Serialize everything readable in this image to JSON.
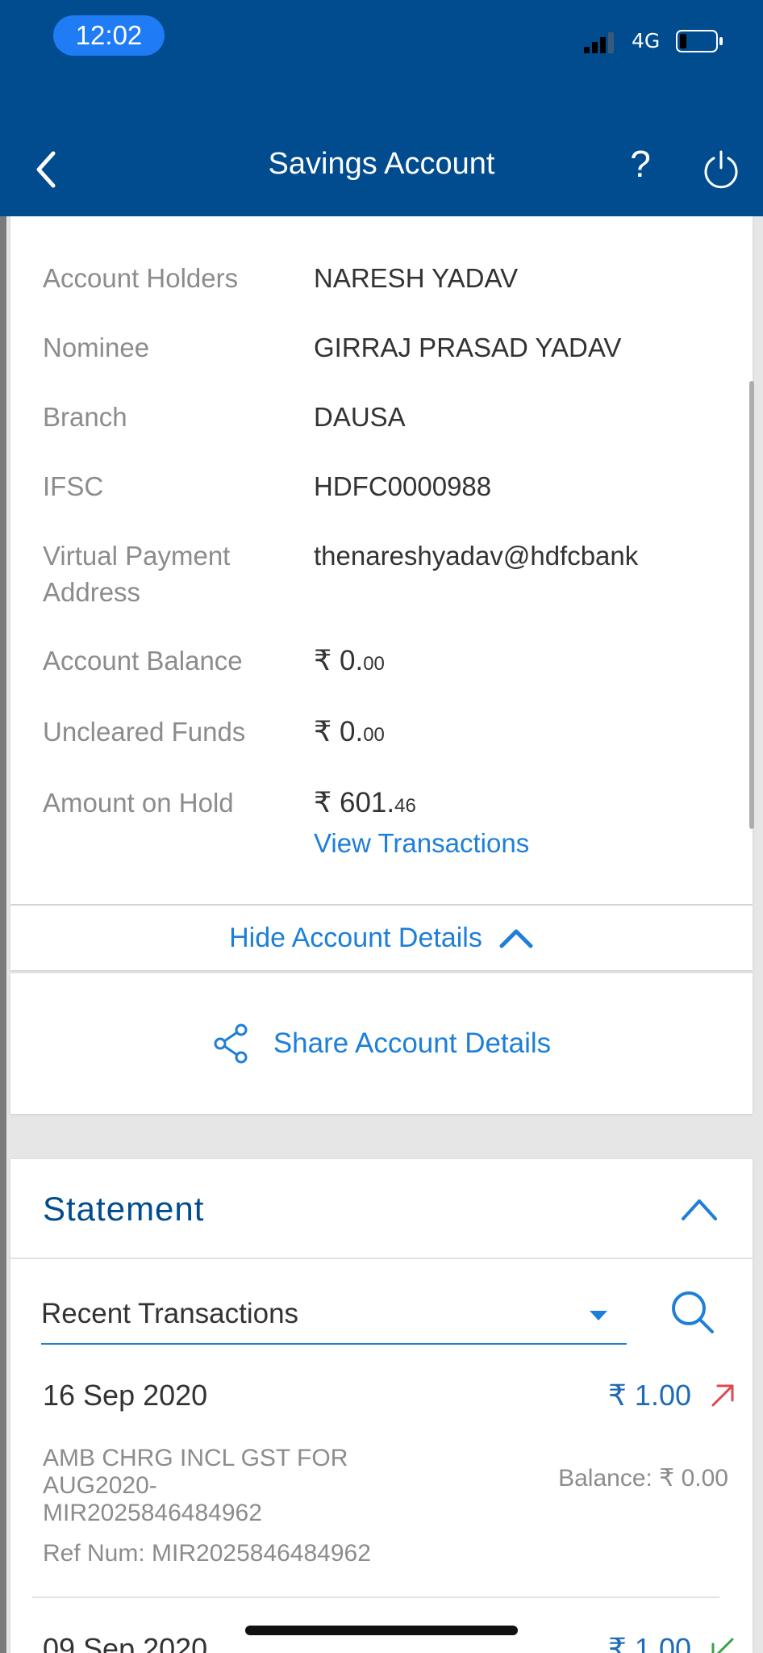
{
  "status_bar": {
    "time": "12:02",
    "network": "4G"
  },
  "header": {
    "title": "Savings Account",
    "help_label": "?"
  },
  "account_details": {
    "holders_label": "Account Holders",
    "holders_value": "NARESH YADAV",
    "nominee_label": "Nominee",
    "nominee_value": "GIRRAJ PRASAD YADAV",
    "branch_label": "Branch",
    "branch_value": "DAUSA",
    "ifsc_label": "IFSC",
    "ifsc_value": "HDFC0000988",
    "vpa_label_line1": "Virtual Payment",
    "vpa_label_line2": "Address",
    "vpa_value": "thenareshyadav@hdfcbank",
    "balance_label": "Account Balance",
    "balance_main": "₹ 0.",
    "balance_dec": "00",
    "uncleared_label": "Uncleared Funds",
    "uncleared_main": "₹ 0.",
    "uncleared_dec": "00",
    "hold_label": "Amount on Hold",
    "hold_main": "₹ 601.",
    "hold_dec": "46",
    "view_transactions": "View Transactions"
  },
  "hide_details_label": "Hide Account Details",
  "share_details_label": "Share Account Details",
  "statement": {
    "title": "Statement",
    "filter_value": "Recent Transactions",
    "transactions": [
      {
        "date": "16 Sep 2020",
        "amount": "₹ 1.00",
        "direction": "debit",
        "desc_line1": "AMB CHRG INCL GST FOR",
        "desc_line2": "AUG2020-",
        "desc_line3": "MIR2025846484962",
        "ref": "Ref Num: MIR2025846484962",
        "balance": "Balance: ₹ 0.00"
      },
      {
        "date": "09 Sep 2020",
        "amount": "₹ 1.00",
        "direction": "credit"
      }
    ]
  },
  "colors": {
    "header_bg": "#004c8f",
    "accent_blue": "#1e7fd8",
    "debit_arrow": "#e0474c",
    "credit_arrow": "#3aa34a"
  }
}
